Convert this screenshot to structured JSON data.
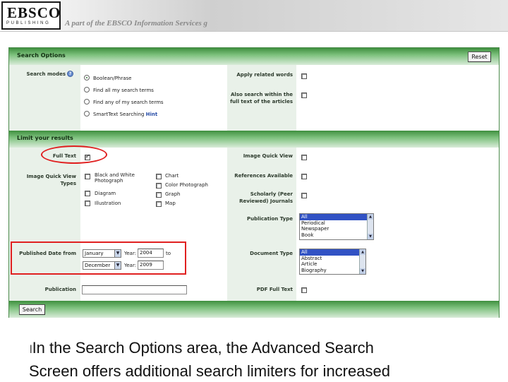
{
  "header": {
    "logo_main": "EBSCO",
    "logo_sub": "PUBLISHING",
    "tagline": "A part of the EBSCO Information Services g"
  },
  "search_options": {
    "title": "Search Options",
    "reset_label": "Reset",
    "search_modes_label": "Search modes",
    "modes": [
      "Boolean/Phrase",
      "Find all my search terms",
      "Find any of my search terms",
      "SmartText Searching"
    ],
    "hint_label": "Hint",
    "apply_related_label": "Apply related words",
    "also_search_label": "Also search within the full text of the articles"
  },
  "limit": {
    "title": "Limit your results",
    "full_text_label": "Full Text",
    "image_quick_view_types_label": "Image Quick View Types",
    "image_types_col1": [
      "Black and White Photograph",
      "Diagram",
      "Illustration"
    ],
    "image_types_col2": [
      "Chart",
      "Color Photograph",
      "Graph",
      "Map"
    ],
    "published_date_label": "Published Date from",
    "from_month": "January",
    "from_year_label": "Year:",
    "from_year": "2004",
    "to_label": "to",
    "to_month": "December",
    "to_year_label": "Year:",
    "to_year": "2009",
    "publication_label": "Publication",
    "publication_value": "",
    "image_quick_view_label": "Image Quick View",
    "references_available_label": "References Available",
    "scholarly_label": "Scholarly (Peer Reviewed) Journals",
    "publication_type_label": "Publication Type",
    "publication_types": [
      "All",
      "Periodical",
      "Newspaper",
      "Book"
    ],
    "document_type_label": "Document Type",
    "document_types": [
      "All",
      "Abstract",
      "Article",
      "Biography"
    ],
    "pdf_full_text_label": "PDF Full Text"
  },
  "search_button_label": "Search",
  "caption": {
    "bullet": "l",
    "line1": "In the Search Options area, the Advanced Search",
    "line2": "Screen offers additional search limiters for increased"
  },
  "colors": {
    "panel_green": "#3f8f3f",
    "highlight_red": "#e02020",
    "selection_blue": "#3152c4"
  }
}
